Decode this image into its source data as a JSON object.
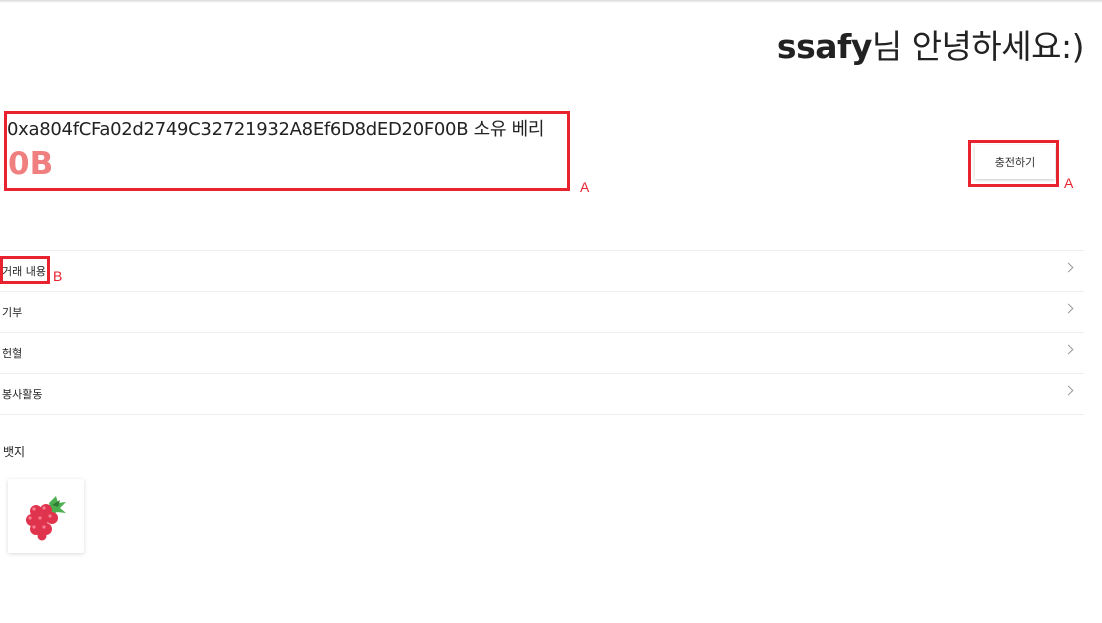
{
  "header": {
    "greeting_user": "ssafy",
    "greeting_suffix": "님 안녕하세요:)"
  },
  "wallet": {
    "owner_line": "0xa804fCFa02d2749C32721932A8Ef6D8dED20F00B 소유 베리",
    "balance": "0B",
    "charge_label": "충전하기"
  },
  "annotations": {
    "a1": "A",
    "a2": "A",
    "b": "B"
  },
  "menu": {
    "items": [
      {
        "label": "거래 내용"
      },
      {
        "label": "기부"
      },
      {
        "label": "헌혈"
      },
      {
        "label": "봉사활동"
      }
    ]
  },
  "badges": {
    "title": "뱃지",
    "items": [
      {
        "icon": "raspberry-icon"
      }
    ]
  },
  "colors": {
    "balance": "#f08080",
    "annotation": "#e8232f"
  }
}
